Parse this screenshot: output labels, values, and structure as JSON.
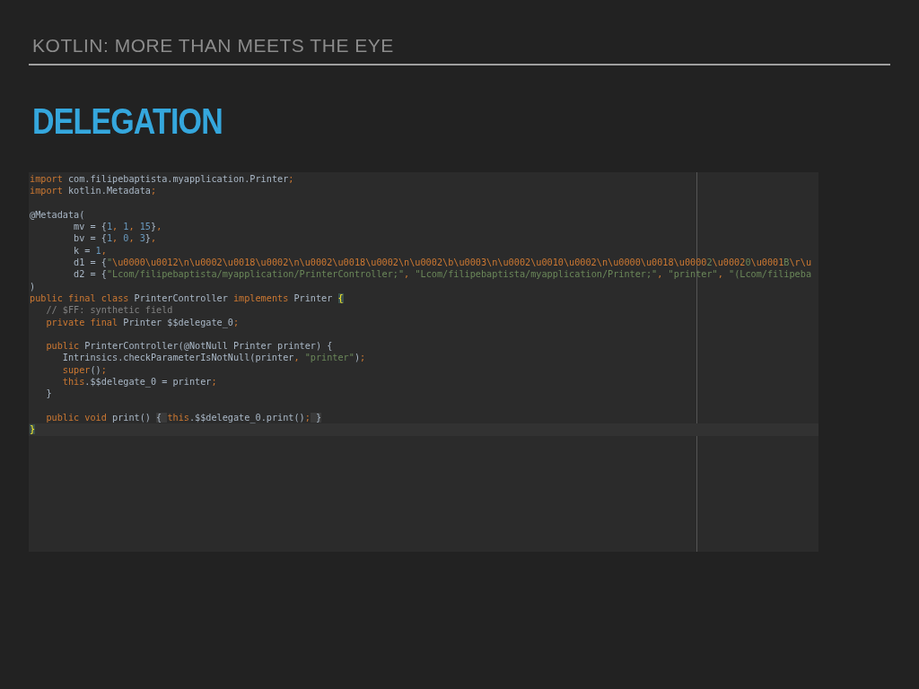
{
  "slide": {
    "header": "KOTLIN: MORE THAN MEETS THE EYE",
    "title": "DELEGATION"
  },
  "editor": {
    "lines": [
      {
        "current": false,
        "tokens": [
          {
            "kind": "kw",
            "text": "import"
          },
          {
            "kind": "plain",
            "text": " com.filipebaptista.myapplication.Printer"
          },
          {
            "kind": "kw",
            "text": ";"
          }
        ]
      },
      {
        "current": false,
        "tokens": [
          {
            "kind": "kw",
            "text": "import"
          },
          {
            "kind": "plain",
            "text": " kotlin.Metadata"
          },
          {
            "kind": "kw",
            "text": ";"
          }
        ]
      },
      {
        "current": false
      },
      {
        "current": false,
        "tokens": [
          {
            "kind": "plain",
            "text": "@Metadata("
          }
        ]
      },
      {
        "current": false,
        "tokens": [
          {
            "kind": "plain",
            "text": "        mv = {"
          },
          {
            "kind": "num",
            "text": "1"
          },
          {
            "kind": "kw",
            "text": ", "
          },
          {
            "kind": "num",
            "text": "1"
          },
          {
            "kind": "kw",
            "text": ", "
          },
          {
            "kind": "num",
            "text": "15"
          },
          {
            "kind": "plain",
            "text": "}"
          },
          {
            "kind": "kw",
            "text": ","
          }
        ]
      },
      {
        "current": false,
        "tokens": [
          {
            "kind": "plain",
            "text": "        bv = {"
          },
          {
            "kind": "num",
            "text": "1"
          },
          {
            "kind": "kw",
            "text": ", "
          },
          {
            "kind": "num",
            "text": "0"
          },
          {
            "kind": "kw",
            "text": ", "
          },
          {
            "kind": "num",
            "text": "3"
          },
          {
            "kind": "plain",
            "text": "}"
          },
          {
            "kind": "kw",
            "text": ","
          }
        ]
      },
      {
        "current": false,
        "tokens": [
          {
            "kind": "plain",
            "text": "        k = "
          },
          {
            "kind": "num",
            "text": "1"
          },
          {
            "kind": "kw",
            "text": ","
          }
        ]
      },
      {
        "current": false,
        "tokens": [
          {
            "kind": "plain",
            "text": "        d1 = {"
          },
          {
            "kind": "str",
            "text": "\""
          },
          {
            "kind": "esc",
            "text": "\\u0000\\u0012\\n\\u0002\\u0018\\u0002\\n\\u0002\\u0018\\u0002\\n\\u0002\\b\\u0003\\n\\u0002\\u0010\\u0002\\n\\u0000\\u0018\\u0000"
          },
          {
            "kind": "str",
            "text": "2"
          },
          {
            "kind": "esc",
            "text": "\\u0002"
          },
          {
            "kind": "str",
            "text": "0"
          },
          {
            "kind": "esc",
            "text": "\\u0001"
          },
          {
            "kind": "str",
            "text": "B"
          },
          {
            "kind": "esc",
            "text": "\\r\\u"
          }
        ]
      },
      {
        "current": false,
        "tokens": [
          {
            "kind": "plain",
            "text": "        d2 = {"
          },
          {
            "kind": "str",
            "text": "\"Lcom/filipebaptista/myapplication/PrinterController;\""
          },
          {
            "kind": "kw",
            "text": ", "
          },
          {
            "kind": "str",
            "text": "\"Lcom/filipebaptista/myapplication/Printer;\""
          },
          {
            "kind": "kw",
            "text": ", "
          },
          {
            "kind": "str",
            "text": "\"printer\""
          },
          {
            "kind": "kw",
            "text": ", "
          },
          {
            "kind": "str",
            "text": "\"(Lcom/filipeba"
          }
        ]
      },
      {
        "current": false,
        "tokens": [
          {
            "kind": "plain",
            "text": ")"
          }
        ]
      },
      {
        "current": false,
        "tokens": [
          {
            "kind": "kw",
            "text": "public final class "
          },
          {
            "kind": "plain",
            "text": "PrinterController "
          },
          {
            "kind": "kw",
            "text": "implements "
          },
          {
            "kind": "plain",
            "text": "Printer "
          },
          {
            "kind": "match",
            "text": "{"
          }
        ]
      },
      {
        "current": false,
        "tokens": [
          {
            "kind": "comment",
            "text": "   // $FF: synthetic field"
          }
        ]
      },
      {
        "current": false,
        "tokens": [
          {
            "kind": "kw",
            "text": "   private final "
          },
          {
            "kind": "plain",
            "text": "Printer $$delegate_0"
          },
          {
            "kind": "kw",
            "text": ";"
          }
        ]
      },
      {
        "current": false
      },
      {
        "current": false,
        "tokens": [
          {
            "kind": "kw",
            "text": "   public "
          },
          {
            "kind": "plain",
            "text": "PrinterController(@NotNull Printer printer) {"
          }
        ]
      },
      {
        "current": false,
        "tokens": [
          {
            "kind": "plain",
            "text": "      Intrinsics.checkParameterIsNotNull(printer"
          },
          {
            "kind": "kw",
            "text": ", "
          },
          {
            "kind": "str",
            "text": "\"printer\""
          },
          {
            "kind": "plain",
            "text": ")"
          },
          {
            "kind": "kw",
            "text": ";"
          }
        ]
      },
      {
        "current": false,
        "tokens": [
          {
            "kind": "kw",
            "text": "      super"
          },
          {
            "kind": "plain",
            "text": "()"
          },
          {
            "kind": "kw",
            "text": ";"
          }
        ]
      },
      {
        "current": false,
        "tokens": [
          {
            "kind": "kw",
            "text": "      this"
          },
          {
            "kind": "plain",
            "text": ".$$delegate_0 = printer"
          },
          {
            "kind": "kw",
            "text": ";"
          }
        ]
      },
      {
        "current": false,
        "tokens": [
          {
            "kind": "plain",
            "text": "   }"
          }
        ]
      },
      {
        "current": false
      },
      {
        "current": false,
        "tokens": [
          {
            "kind": "kw",
            "text": "   public void "
          },
          {
            "kind": "plain",
            "text": "print() "
          },
          {
            "kind": "fold",
            "text": "{ "
          },
          {
            "kind": "kw",
            "text": "this"
          },
          {
            "kind": "plain",
            "text": ".$$delegate_0.print()"
          },
          {
            "kind": "kw",
            "text": ";"
          },
          {
            "kind": "fold",
            "text": " }"
          }
        ]
      },
      {
        "current": true,
        "tokens": [
          {
            "kind": "match",
            "text": "}"
          }
        ]
      }
    ]
  }
}
